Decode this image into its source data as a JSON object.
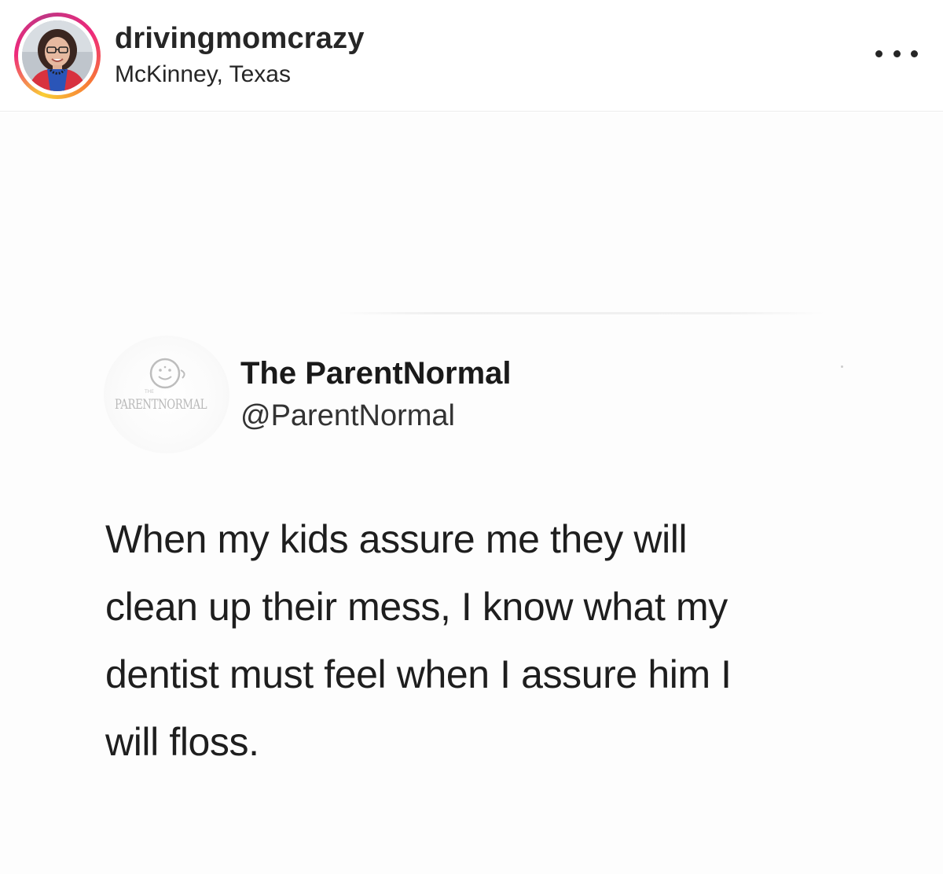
{
  "post": {
    "username": "drivingmomcrazy",
    "location": "McKinney, Texas",
    "avatar_icon": "profile-photo",
    "more_icon": "more-options-icon",
    "story_ring_colors": [
      "#f9ce34",
      "#ee2a7b",
      "#c13584",
      "#f77737"
    ]
  },
  "tweet": {
    "display_name": "The ParentNormal",
    "handle": "@ParentNormal",
    "logo_text": "PARENTNORMAL",
    "logo_icon": "smiley-face-icon",
    "text_lines": [
      "When my kids assure me they will",
      "clean up their mess, I know what my",
      "dentist must feel when I assure him I",
      "will floss."
    ]
  }
}
